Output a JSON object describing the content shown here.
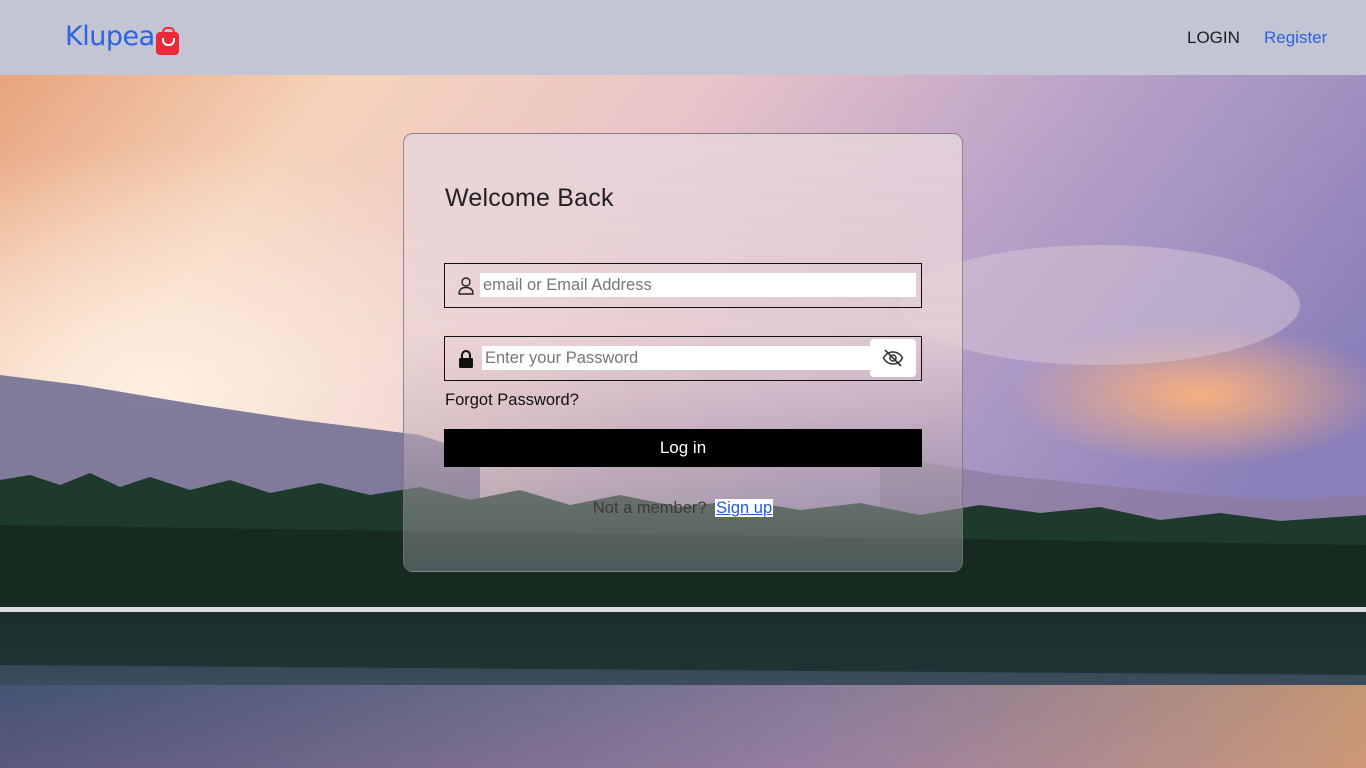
{
  "header": {
    "logo_text": "Klupea",
    "nav": {
      "login": "LOGIN",
      "register": "Register"
    }
  },
  "login_card": {
    "title": "Welcome Back",
    "email_placeholder": "email or Email Address",
    "password_placeholder": "Enter your Password",
    "forgot_password": "Forgot Password?",
    "login_button": "Log in",
    "not_member": "Not a member?",
    "signup_link": "Sign up"
  },
  "icons": {
    "logo": "shopping-bag-icon",
    "email_field": "user-icon",
    "password_field": "lock-icon",
    "toggle_password": "eye-slash-icon"
  },
  "colors": {
    "header_bg": "#c3c5d4",
    "brand_blue": "#2f62e0",
    "brand_red": "#ea2a38",
    "button_bg": "#000000"
  }
}
